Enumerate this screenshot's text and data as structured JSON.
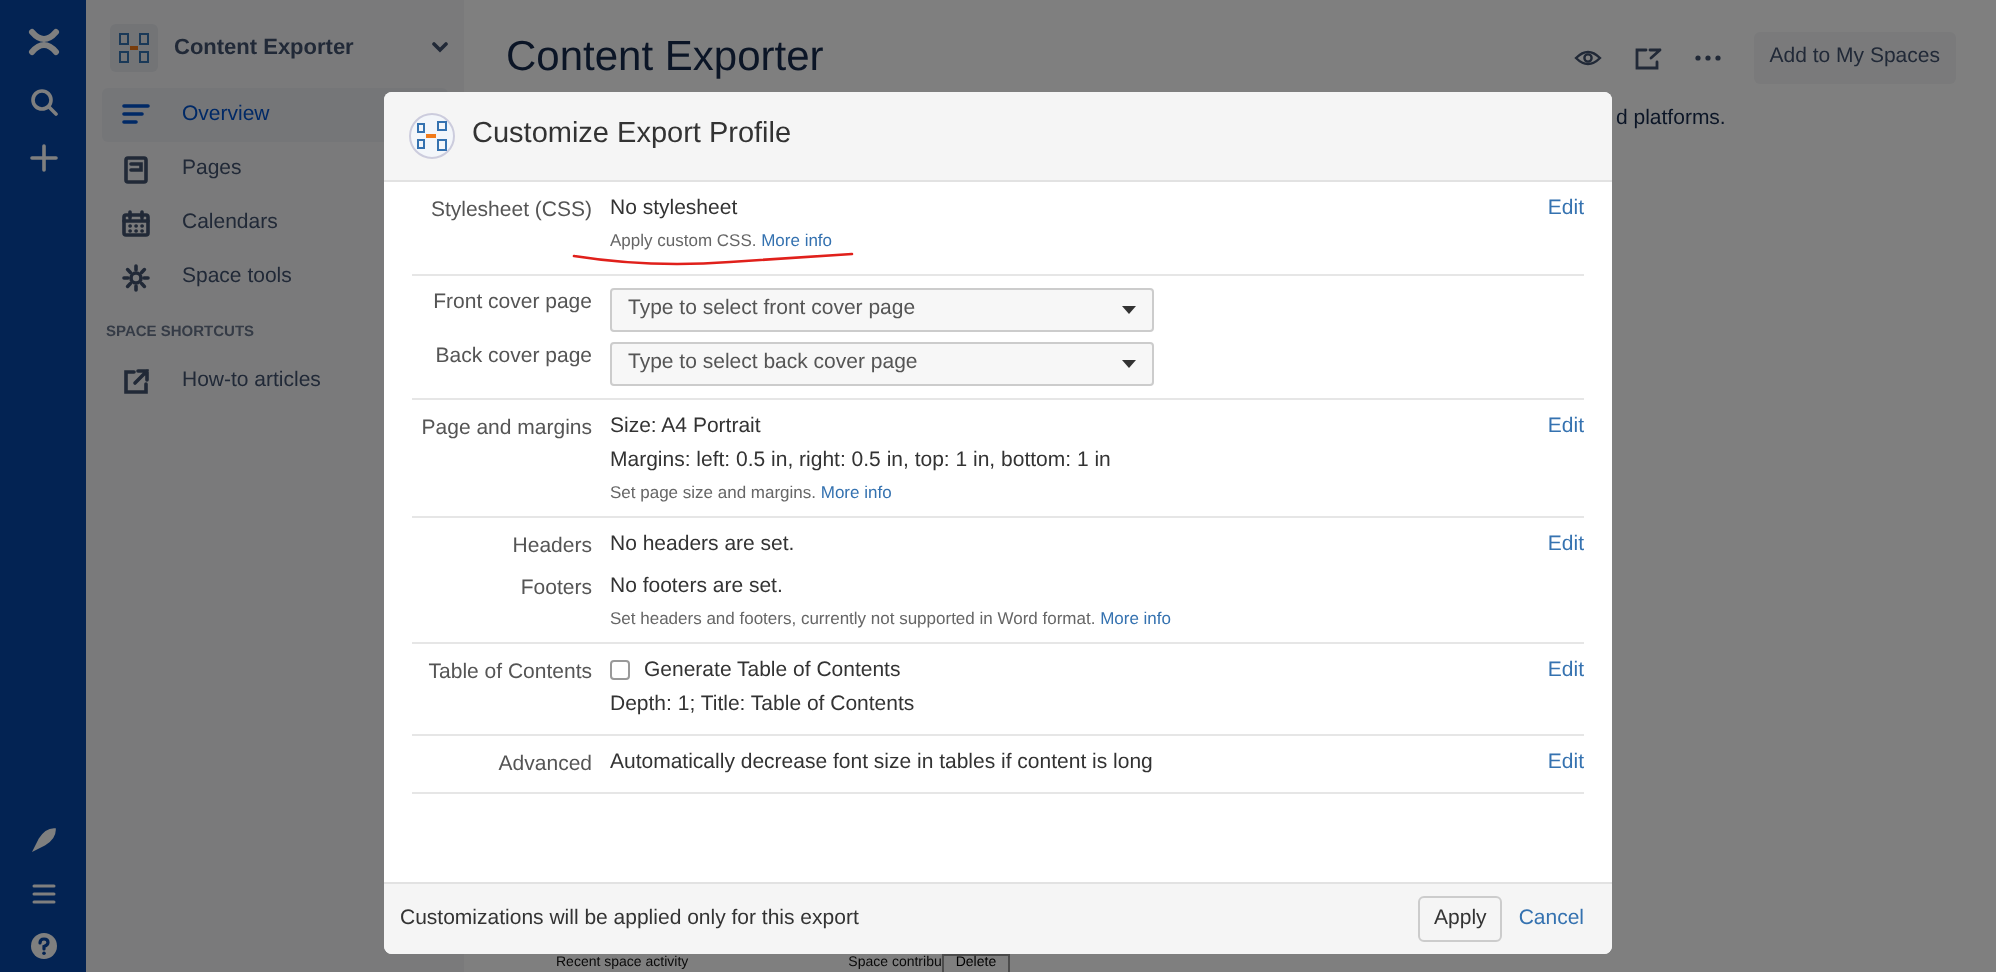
{
  "sidebar": {
    "space_title": "Content Exporter",
    "items": [
      {
        "label": "Overview",
        "selected": true
      },
      {
        "label": "Pages",
        "selected": false
      },
      {
        "label": "Calendars",
        "selected": false
      },
      {
        "label": "Space tools",
        "selected": false
      }
    ],
    "section_heading": "SPACE SHORTCUTS",
    "shortcuts": [
      {
        "label": "How-to articles"
      }
    ]
  },
  "page": {
    "title": "Content Exporter",
    "add_button": "Add to My Spaces",
    "body_text": "d platforms.",
    "background_texts": [
      "Recent space activity",
      "Space contribu",
      "Delete"
    ]
  },
  "dialog": {
    "title": "Customize Export Profile",
    "sections": [
      {
        "rows": [
          {
            "kind": "info",
            "label": "Stylesheet (CSS)",
            "lines": [
              "No stylesheet"
            ],
            "hint": "Apply custom CSS.",
            "hint_link": "More info",
            "action": "Edit"
          }
        ]
      },
      {
        "rows": [
          {
            "kind": "select",
            "label": "Front cover page",
            "placeholder": "Type to select front cover page"
          },
          {
            "kind": "select",
            "label": "Back cover page",
            "placeholder": "Type to select back cover page"
          }
        ]
      },
      {
        "rows": [
          {
            "kind": "info",
            "label": "Page and margins",
            "lines": [
              "Size: A4 Portrait",
              "Margins: left: 0.5 in, right: 0.5 in, top: 1 in, bottom: 1 in"
            ],
            "hint": "Set page size and margins.",
            "hint_link": "More info",
            "action": "Edit"
          }
        ]
      },
      {
        "rows": [
          {
            "kind": "info",
            "label": "Headers",
            "lines": [
              "No headers are set."
            ],
            "action": "Edit"
          },
          {
            "kind": "info",
            "label": "Footers",
            "lines": [
              "No footers are set."
            ],
            "hint": "Set headers and footers, currently not supported in Word format.",
            "hint_link": "More info"
          }
        ]
      },
      {
        "rows": [
          {
            "kind": "checkbox",
            "label": "Table of Contents",
            "checkbox_label": "Generate Table of Contents",
            "checked": false,
            "lines": [
              "Depth: 1; Title: Table of Contents"
            ],
            "action": "Edit"
          }
        ]
      },
      {
        "rows": [
          {
            "kind": "info",
            "label": "Advanced",
            "lines": [
              "Automatically decrease font size in tables if content is long"
            ],
            "action": "Edit"
          }
        ]
      }
    ],
    "footer_note": "Customizations will be applied only for this export",
    "buttons": [
      {
        "label": "Apply"
      },
      {
        "label": "Cancel"
      }
    ]
  }
}
